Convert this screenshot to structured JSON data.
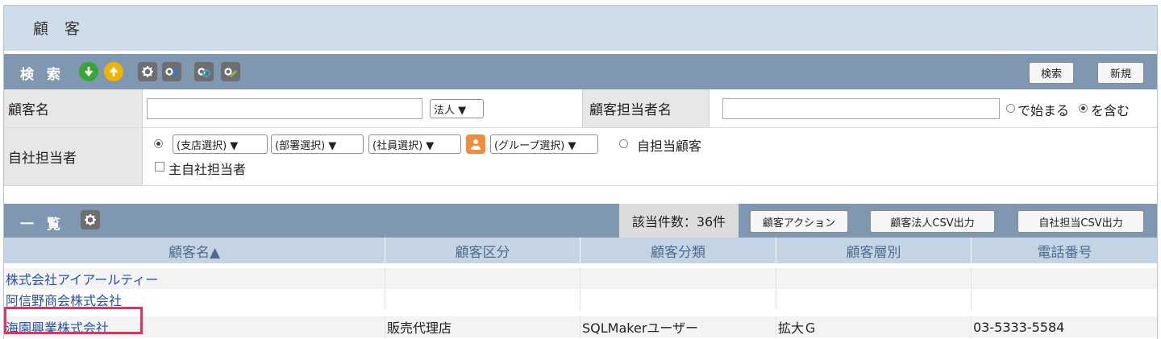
{
  "page": {
    "title": "顧 客"
  },
  "search": {
    "title": "検 索",
    "icons": [
      {
        "name": "download-icon",
        "color": "#3aa534"
      },
      {
        "name": "upload-icon",
        "color": "#f0b400"
      },
      {
        "name": "gear-icon",
        "color": "#777777"
      },
      {
        "name": "user-settings-icon",
        "color": "#777777"
      },
      {
        "name": "refresh-settings-icon",
        "color": "#777777"
      },
      {
        "name": "edit-settings-icon",
        "color": "#777777"
      }
    ],
    "search_button": "検索",
    "new_button": "新規"
  },
  "form": {
    "customer_name_label": "顧客名",
    "customer_name_value": "",
    "corp_type_select": "法人 ▼",
    "staff_name_label": "顧客担当者名",
    "staff_name_value": "",
    "starts_with_label": "で始まる",
    "contains_label": "を含む",
    "own_staff_label": "自社担当者",
    "branch_select": "(支店選択) ▼",
    "dept_select": "(部署選択) ▼",
    "employee_select": "(社員選択) ▼",
    "group_select": "(グループ選択) ▼",
    "own_customer_label": "自担当顧客",
    "main_staff_label": "主自社担当者"
  },
  "list": {
    "title": "一 覧",
    "count_label": "該当件数：36件",
    "action_button": "顧客アクション",
    "csv_button": "顧客法人CSV出力",
    "own_csv_button": "自社担当CSV出力",
    "columns": [
      "顧客名▲",
      "顧客区分",
      "顧客分類",
      "顧客層別",
      "電話番号"
    ],
    "rows": [
      [
        "株式会社アイアールティー",
        "",
        "",
        "",
        ""
      ],
      [
        "阿信野商会株式会社",
        "",
        "",
        "",
        ""
      ],
      [
        "海園興業株式会社",
        "販売代理店",
        "SQLMakerユーザー",
        "拡大Ｇ",
        "03-5333-5584"
      ]
    ]
  },
  "colors": {
    "accent": "#7f97b1",
    "title_bg": "#cfdcea",
    "highlight": "#e0345a",
    "link": "#2850a8"
  }
}
